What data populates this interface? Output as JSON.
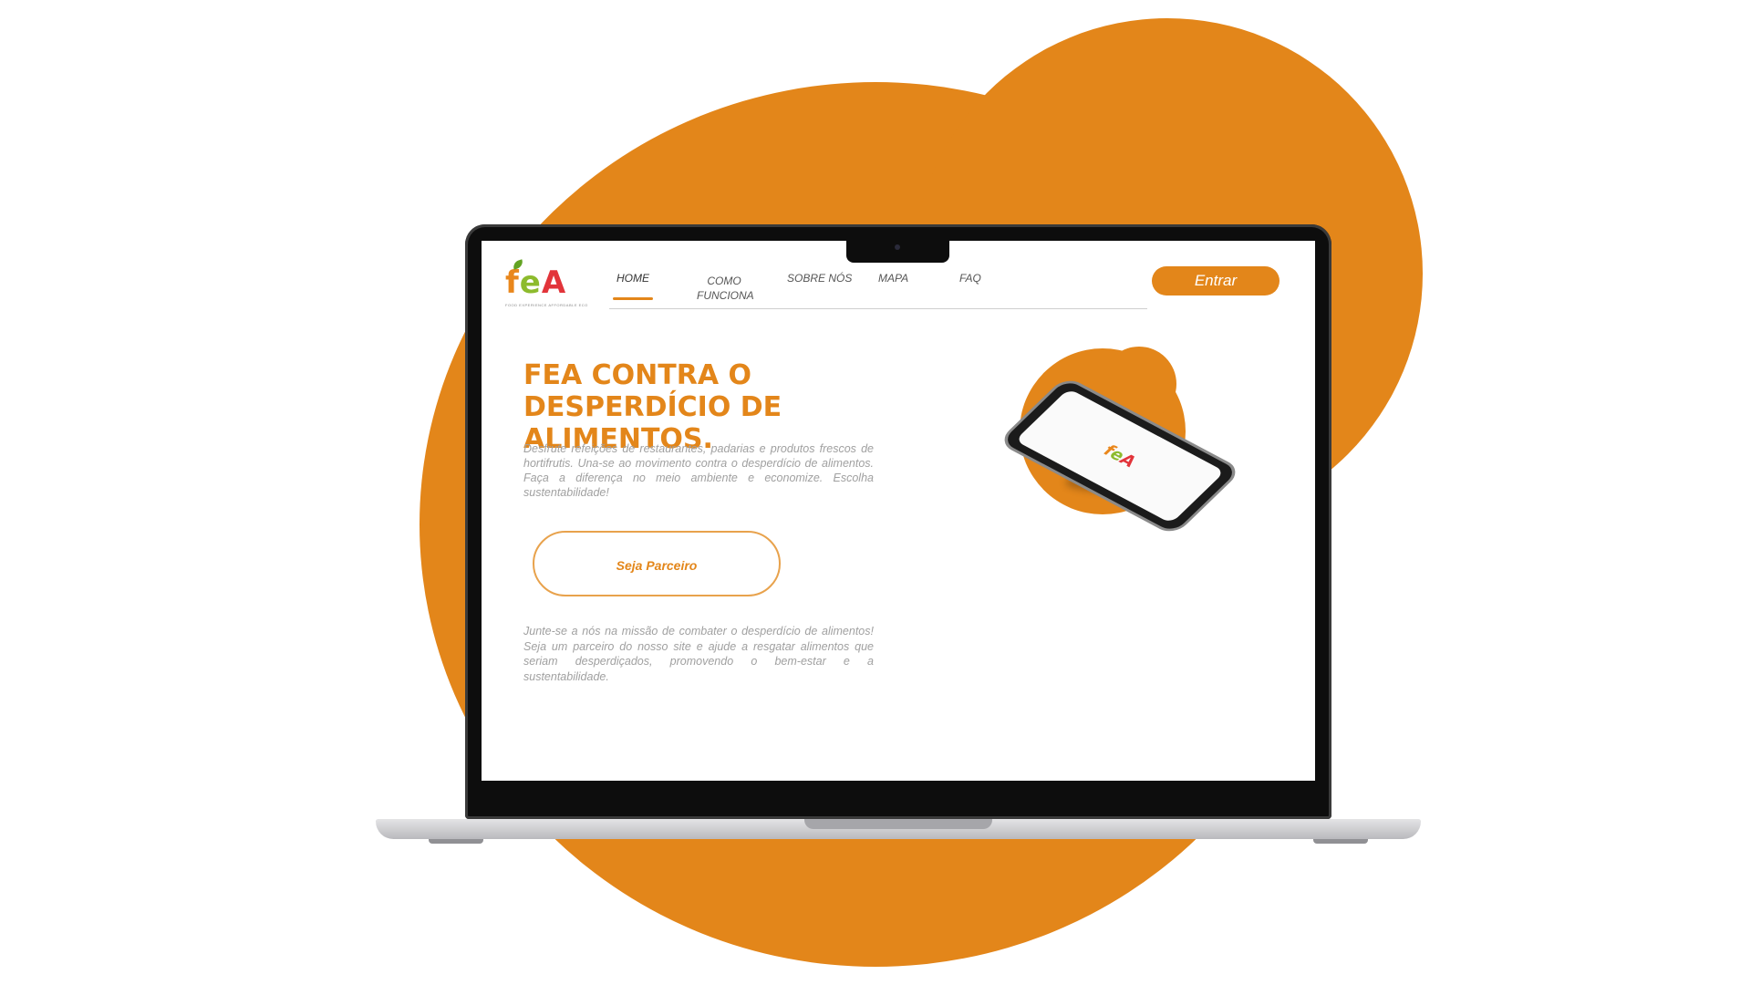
{
  "colors": {
    "accent": "#e3861a",
    "background": "#ffffff",
    "text_muted": "#a0a0a0"
  },
  "logo": {
    "letters": [
      "f",
      "e",
      "A"
    ],
    "tagline": "FOOD EXPERIENCE AFFORDABLE ECO"
  },
  "nav": {
    "home": "HOME",
    "como_funciona": "COMO FUNCIONA",
    "sobre_nos": "SOBRE NÓS",
    "mapa": "MAPA",
    "faq": "FAQ"
  },
  "entrar_label": "Entrar",
  "hero": {
    "title": "FEA CONTRA O DESPERDÍCIO DE ALIMENTOS.",
    "text": "Desfrute refeições de restaurantes, padarias e produtos frescos de hortifrutis. Una-se ao movimento contra o desperdício de alimentos. Faça a diferença no meio ambiente e economize. Escolha sustentabilidade!",
    "button_label": "Seja Parceiro",
    "mission": "Junte-se a nós na missão de combater o desperdício de alimentos! Seja um parceiro do nosso site e ajude a resgatar alimentos que seriam desperdiçados, promovendo o bem-estar e a sustentabilidade."
  },
  "phone_logo": {
    "f": "f",
    "e": "e",
    "a": "A"
  },
  "icons": [
    "camera-icon",
    "phone-illustration"
  ]
}
